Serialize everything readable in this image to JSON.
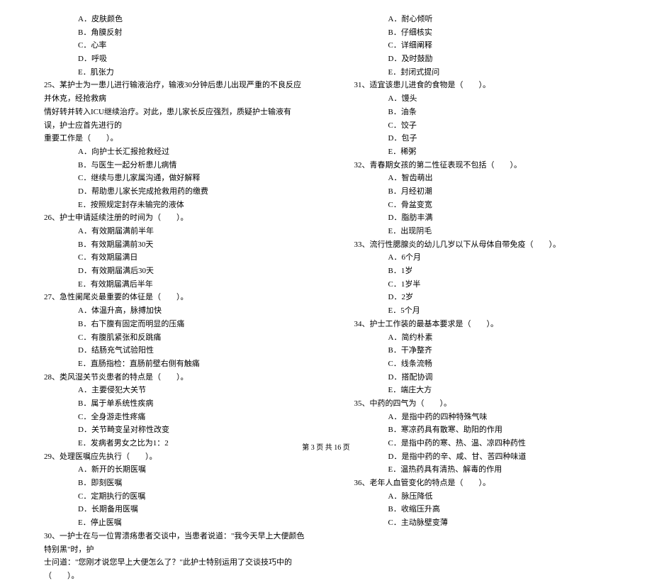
{
  "left": {
    "q24_opts": [
      "A．皮肤颜色",
      "B．角膜反射",
      "C．心率",
      "D．呼吸",
      "E．肌张力"
    ],
    "q25": "25、某护士为一患儿进行输液治疗，输液30分钟后患儿出现严重的不良反应并休克，经抢救病",
    "q25_line2": "情好转并转入ICU继续治疗。对此，患儿家长反应强烈，质疑护士输液有误，护士应首先进行的",
    "q25_line3": "重要工作是（　　）。",
    "q25_opts": [
      "A．向护士长汇报抢救经过",
      "B．与医生一起分析患儿病情",
      "C．继续与患儿家属沟通，做好解释",
      "D．帮助患儿家长完成抢救用药的缴费",
      "E．按照规定封存未输完的液体"
    ],
    "q26": "26、护士申请延续注册的时间为（　　）。",
    "q26_opts": [
      "A．有效期届满前半年",
      "B．有效期届满前30天",
      "C．有效期届满日",
      "D．有效期届满后30天",
      "E．有效期届满后半年"
    ],
    "q27": "27、急性阑尾炎最重要的体征是（　　）。",
    "q27_opts": [
      "A．体温升高，脉搏加快",
      "B．右下腹有固定而明显的压痛",
      "C．有腹肌紧张和反跳痛",
      "D．结肠充气试验阳性",
      "E．直肠指检：直肠前壁右侧有触痛"
    ],
    "q28": "28、类风湿关节炎患者的特点是（　　）。",
    "q28_opts": [
      "A．主要侵犯大关节",
      "B．属于单系统性疾病",
      "C．全身游走性疼痛",
      "D．关节畸变呈对称性改变",
      "E．发病者男女之比为1：2"
    ],
    "q29": "29、处理医嘱应先执行（　　）。",
    "q29_opts": [
      "A．新开的长期医嘱",
      "B．即刻医嘱",
      "C．定期执行的医嘱",
      "D．长期备用医嘱",
      "E．停止医嘱"
    ],
    "q30": "30、一护士在与一位胃溃疡患者交谈中，当患者说道：\"我今天早上大便颜色特别黑\"时，护",
    "q30_line2": "士问道：\"您刚才说您早上大便怎么了？\"此护士特别运用了交谈技巧中的（　　）。"
  },
  "right": {
    "q30_opts": [
      "A．耐心倾听",
      "B．仔细核实",
      "C．详细阐释",
      "D．及时鼓励",
      "E．封闭式提问"
    ],
    "q31": "31、适宜该患儿进食的食物是（　　）。",
    "q31_opts": [
      "A．馒头",
      "B．油条",
      "C．饺子",
      "D．包子",
      "E．稀粥"
    ],
    "q32": "32、青春期女孩的第二性征表现不包括（　　）。",
    "q32_opts": [
      "A．智齿萌出",
      "B．月经初潮",
      "C．骨盆变宽",
      "D．脂肪丰满",
      "E．出现阴毛"
    ],
    "q33": "33、流行性腮腺炎的幼儿几岁以下从母体自带免疫（　　）。",
    "q33_opts": [
      "A．6个月",
      "B．1岁",
      "C．1岁半",
      "D．2岁",
      "E．5个月"
    ],
    "q34": "34、护士工作装的最基本要求是（　　）。",
    "q34_opts": [
      "A．简约朴素",
      "B．干净整齐",
      "C．线条流畅",
      "D．搭配协调",
      "E．端庄大方"
    ],
    "q35": "35、中药的四气为（　　）。",
    "q35_opts": [
      "A．是指中药的四种特殊气味",
      "B．寒凉药具有散寒、助阳的作用",
      "C．是指中药的寒、热、温、凉四种药性",
      "D．是指中药的辛、咸、甘、苦四种味道",
      "E．温热药具有清热、解毒的作用"
    ],
    "q36": "36、老年人血管变化的特点是（　　）。",
    "q36_opts": [
      "A．脉压降低",
      "B．收缩压升高",
      "C．主动脉壁变薄"
    ]
  },
  "footer": "第 3 页 共 16 页"
}
